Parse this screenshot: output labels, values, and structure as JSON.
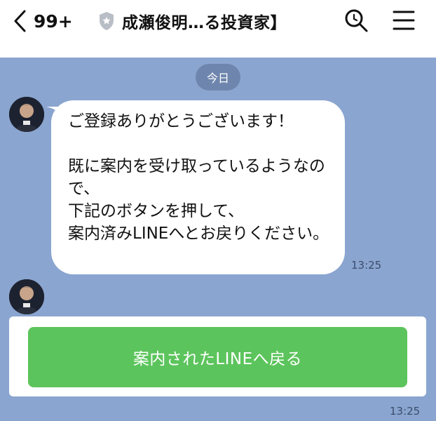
{
  "header": {
    "unread_count": "99+",
    "title": "成瀬俊明…る投資家】",
    "icons": [
      "chevron-left-icon",
      "shield-icon",
      "search-icon",
      "menu-icon"
    ]
  },
  "chat": {
    "date_label": "今日",
    "messages": [
      {
        "text": "ご登録ありがとうございます！\n\n既に案内を受け取っているようなので、\n下記のボタンを押して、\n案内済みLINEへとお戻りください。",
        "time": "13:25"
      },
      {
        "button_label": "案内されたLINEへ戻る",
        "time": "13:25"
      }
    ]
  },
  "colors": {
    "background": "#8aa5cf",
    "button": "#5cc45c",
    "date_chip": "#6e86ad"
  }
}
